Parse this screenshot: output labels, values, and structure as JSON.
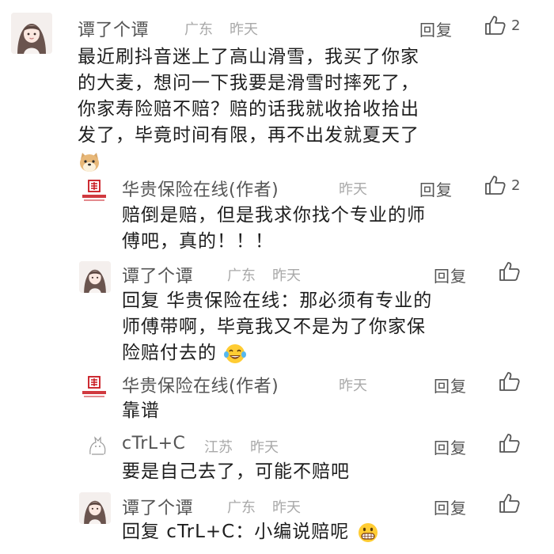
{
  "comments": [
    {
      "username": "谭了个谭",
      "location": "广东",
      "time": "昨天",
      "reply_label": "回复",
      "likes": "2",
      "lines": [
        "最近刷抖音迷上了高山滑雪，我买了你家",
        "的大麦，想问一下我要是滑雪时摔死了，",
        "你家寿险赔不赔？赔的话我就收拾收拾出",
        "发了，毕竟时间有限，再不出发就夏天了"
      ]
    },
    {
      "username": "华贵保险在线(作者)",
      "time": "昨天",
      "reply_label": "回复",
      "likes": "2",
      "avatar_text": "华贵保险",
      "lines": [
        "赔倒是赔，但是我求你找个专业的师",
        "傅吧，真的！！！"
      ]
    },
    {
      "username": "谭了个谭",
      "location": "广东",
      "time": "昨天",
      "reply_label": "回复",
      "lines": [
        "回复 华贵保险在线：那必须有专业的",
        "师傅带啊，毕竟我又不是为了你家保",
        "险赔付去的"
      ]
    },
    {
      "username": "华贵保险在线(作者)",
      "time": "昨天",
      "reply_label": "回复",
      "avatar_text": "华贵保险",
      "lines": [
        "靠谱"
      ]
    },
    {
      "username": "cTrL+C",
      "location": "江苏",
      "time": "昨天",
      "reply_label": "回复",
      "lines": [
        "要是自己去了，可能不赔吧"
      ]
    },
    {
      "username": "谭了个谭",
      "location": "广东",
      "time": "昨天",
      "reply_label": "回复",
      "lines": [
        "回复 cTrL+C：小编说赔呢"
      ]
    }
  ],
  "icons": {
    "like": "thumbs-up-icon",
    "doge": "doge-emoji-icon",
    "laugh": "laughing-tears-emoji-icon",
    "grin": "grinning-emoji-icon"
  },
  "colors": {
    "logo_red": "#c8161d",
    "username": "#555555",
    "meta": "#a9a9a9"
  }
}
